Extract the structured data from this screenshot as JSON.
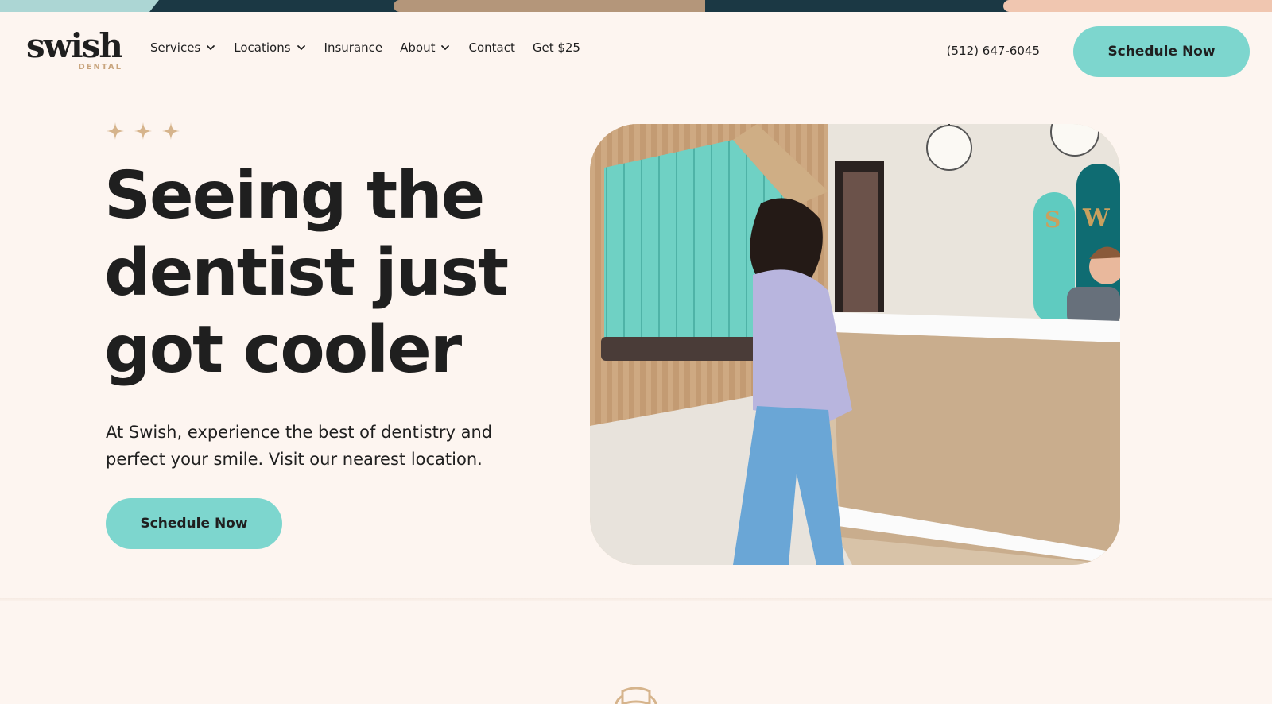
{
  "colors": {
    "background": "#fdf5f0",
    "accent_teal": "#7dd6ce",
    "stripe_light_teal": "#acd6d4",
    "stripe_navy": "#1b3844",
    "stripe_tan": "#b4967a",
    "stripe_peach": "#f0c6b0",
    "gold": "#d6b48c",
    "text": "#1f1f1f"
  },
  "brand": {
    "name": "swish",
    "sub": "DENTAL"
  },
  "nav": {
    "items": [
      {
        "label": "Services",
        "has_dropdown": true
      },
      {
        "label": "Locations",
        "has_dropdown": true
      },
      {
        "label": "Insurance",
        "has_dropdown": false
      },
      {
        "label": "About",
        "has_dropdown": true
      },
      {
        "label": "Contact",
        "has_dropdown": false
      },
      {
        "label": "Get $25",
        "has_dropdown": false
      }
    ],
    "phone": "(512) 647-6045",
    "cta_label": "Schedule Now"
  },
  "hero": {
    "stars_icon": "four-point-sparkle-icon",
    "star_count": 3,
    "headline_lines": [
      "Seeing the",
      "dentist just",
      "got cooler"
    ],
    "subtext": "At Swish, experience the best of dentistry and perfect your smile. Visit our nearest location.",
    "cta_label": "Schedule Now",
    "media_alt": "Patient walking up to the Swish Dental reception desk",
    "media_sign_letters": [
      "S",
      "W"
    ]
  },
  "next_section": {
    "icon": "tooth-chair-outline-icon"
  }
}
